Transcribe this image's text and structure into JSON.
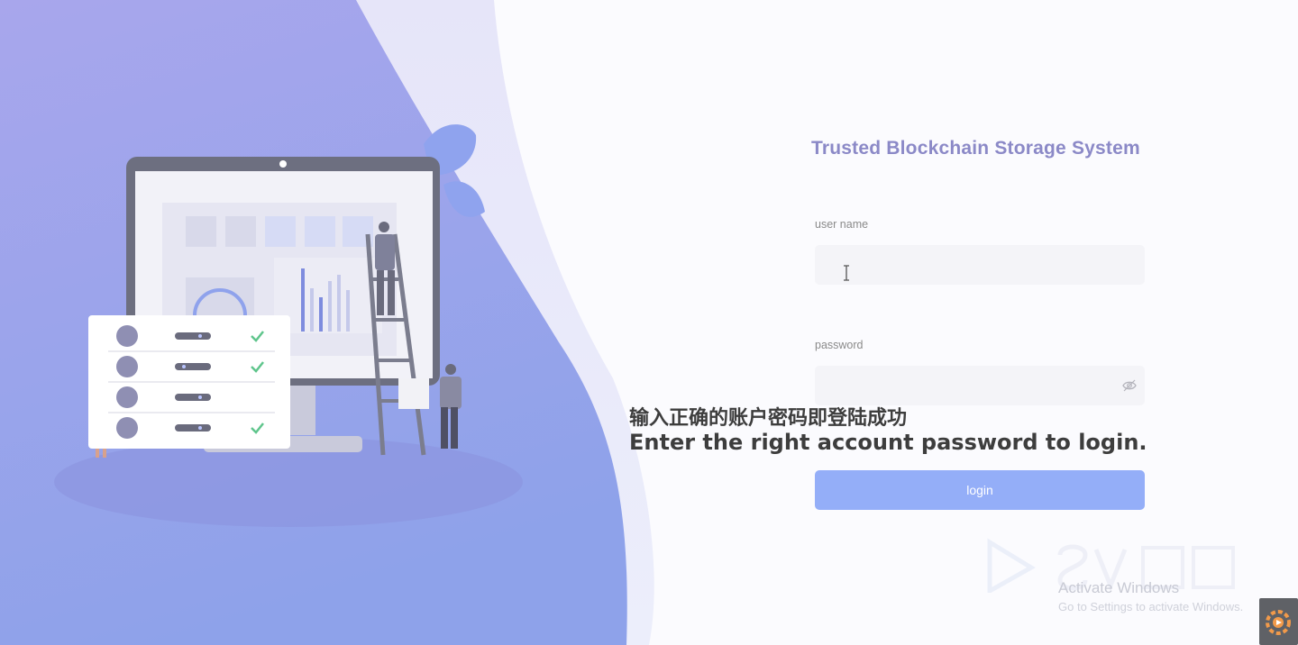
{
  "login": {
    "title": "Trusted Blockchain Storage System",
    "username_label": "user name",
    "username_value": "",
    "password_label": "password",
    "password_value": "",
    "login_label": "login"
  },
  "subtitles": {
    "chinese": "输入正确的账户密码即登陆成功",
    "english": "Enter the right account password to login."
  },
  "watermark": {
    "activate_title": "Activate Windows",
    "activate_hint": "Go to Settings to activate Windows."
  },
  "icons": {
    "text_caret": "text-cursor-icon",
    "password_toggle": "eye-off-icon",
    "corner_badge": "gear-icon"
  },
  "colors": {
    "panel_gradient_top": "#a5a3ea",
    "panel_gradient_bottom": "#8fa2ec",
    "title": "#8b89c7",
    "login_button": "#94aef8",
    "field_background": "#f4f4f8"
  }
}
